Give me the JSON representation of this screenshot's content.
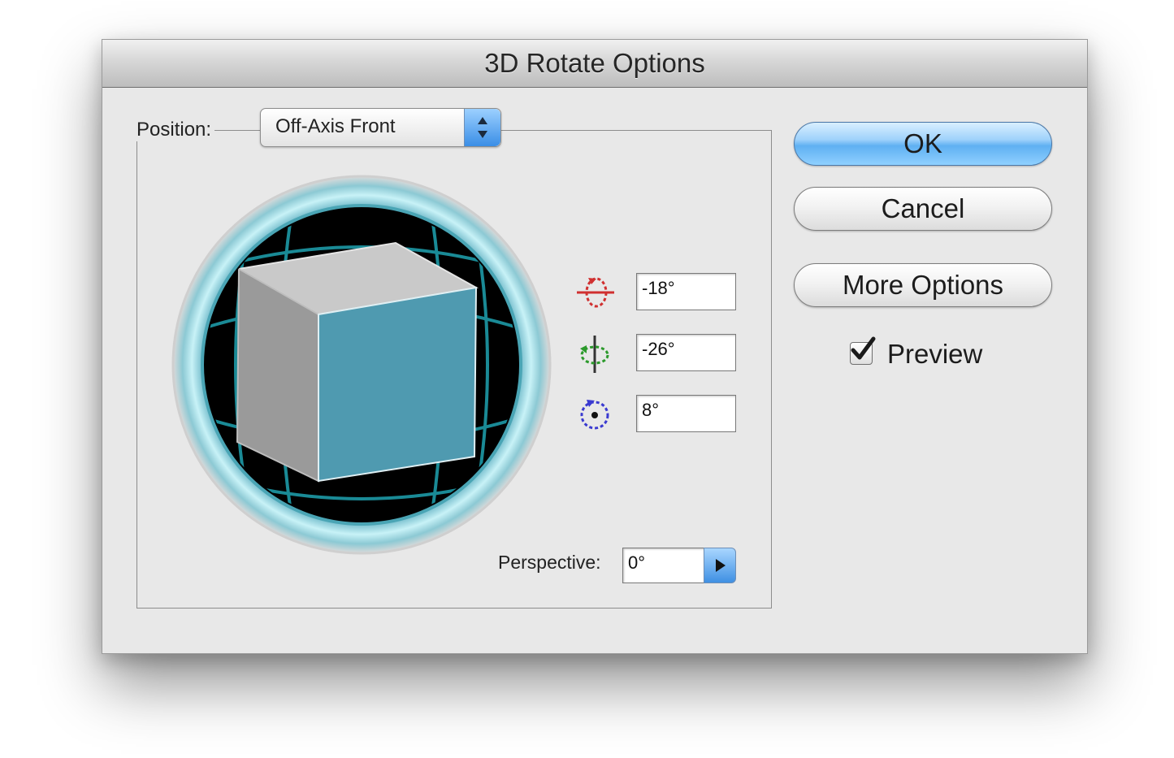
{
  "dialog": {
    "title": "3D Rotate Options"
  },
  "position": {
    "label": "Position:",
    "value": "Off-Axis Front"
  },
  "rotation": {
    "x_value": "-18°",
    "y_value": "-26°",
    "z_value": "8°"
  },
  "perspective": {
    "label": "Perspective:",
    "value": "0°"
  },
  "buttons": {
    "ok": "OK",
    "cancel": "Cancel",
    "more_options": "More Options"
  },
  "preview": {
    "label": "Preview",
    "checked": true
  },
  "icons": {
    "x_axis": "x-axis-rotation-icon",
    "y_axis": "y-axis-rotation-icon",
    "z_axis": "z-axis-rotation-icon",
    "popup_stepper": "up-down-arrows-icon",
    "perspective_menu": "right-triangle-icon",
    "checkmark": "checkmark-icon"
  },
  "colors": {
    "cube_front": "#4f9ab0",
    "cube_top": "#c9c9c9",
    "cube_side": "#9a9a9a",
    "grid_lines": "#1a8a96",
    "trackball_ring": "#9fd8e0",
    "x_axis": "#d03030",
    "y_axis": "#2c9a2c",
    "z_axis": "#3a3ad0",
    "default_button": "#5fb0f2"
  }
}
